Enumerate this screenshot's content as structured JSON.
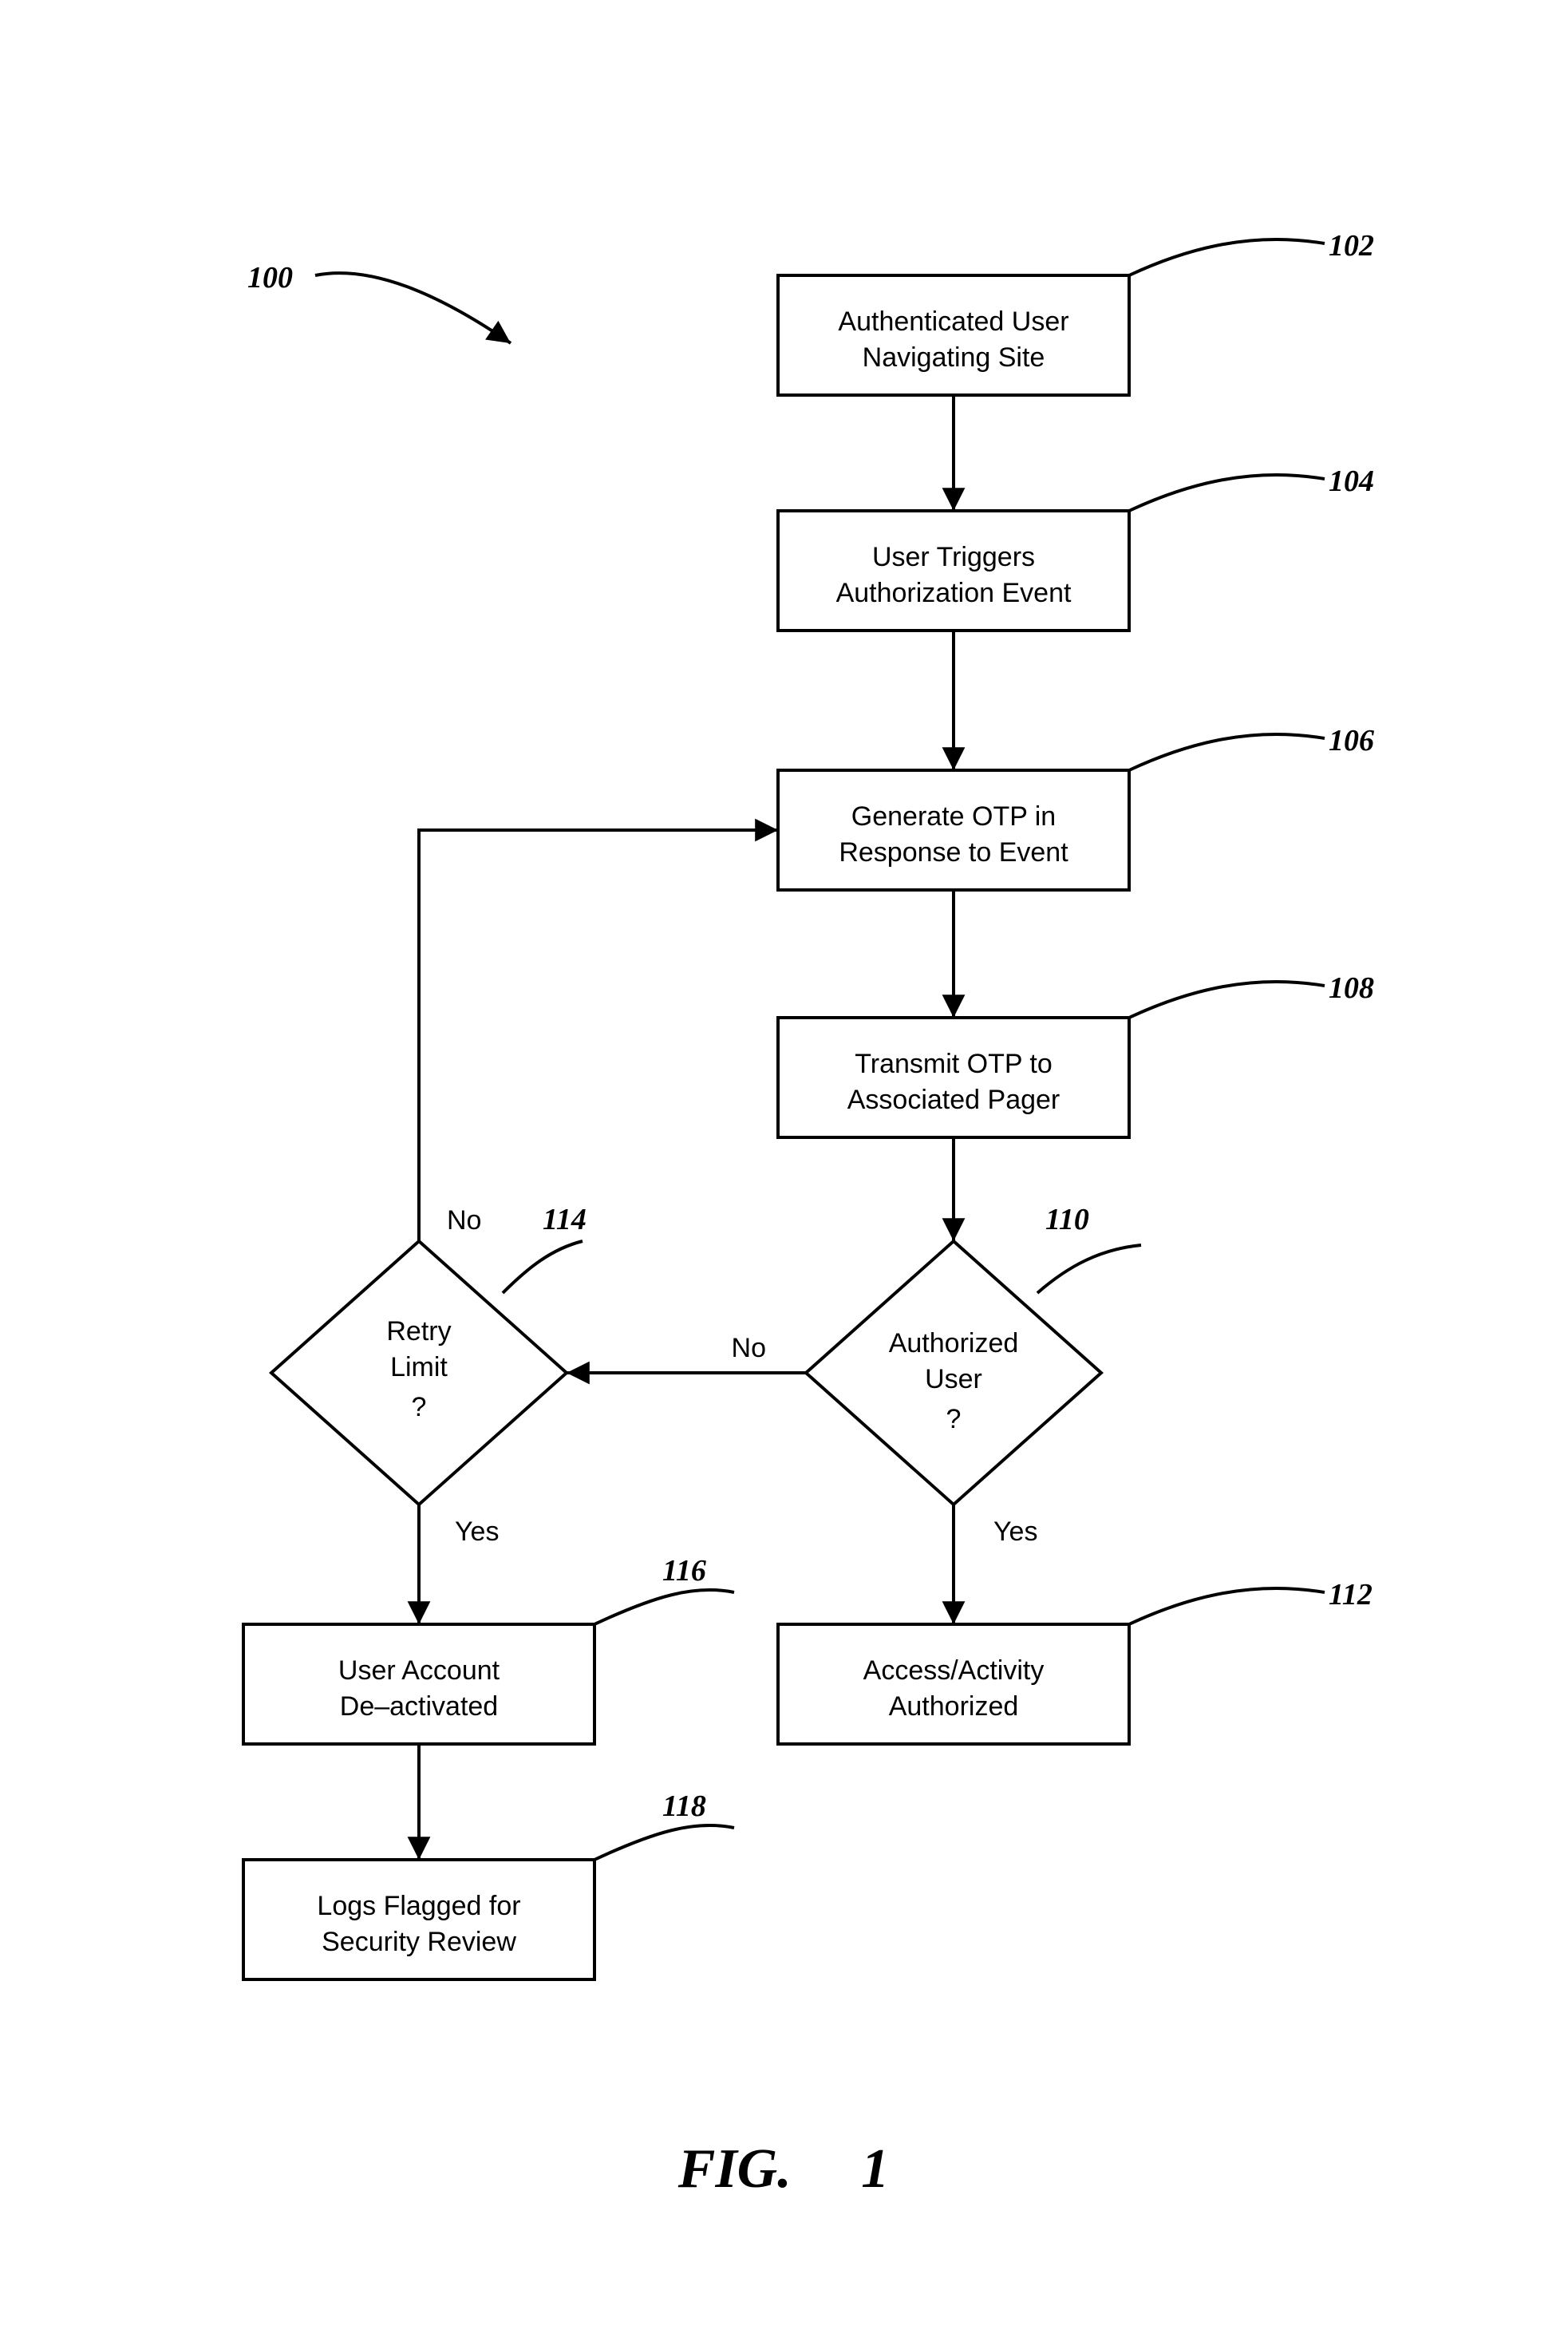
{
  "refs": {
    "r100": "100",
    "r102": "102",
    "r104": "104",
    "r106": "106",
    "r108": "108",
    "r110": "110",
    "r112": "112",
    "r114": "114",
    "r116": "116",
    "r118": "118"
  },
  "boxes": {
    "b102": {
      "l1": "Authenticated User",
      "l2": "Navigating Site"
    },
    "b104": {
      "l1": "User Triggers",
      "l2": "Authorization Event"
    },
    "b106": {
      "l1": "Generate OTP in",
      "l2": "Response to Event"
    },
    "b108": {
      "l1": "Transmit OTP to",
      "l2": "Associated Pager"
    },
    "d110": {
      "l1": "Authorized",
      "l2": "User",
      "l3": "?"
    },
    "b112": {
      "l1": "Access/Activity",
      "l2": "Authorized"
    },
    "d114": {
      "l1": "Retry",
      "l2": "Limit",
      "l3": "?"
    },
    "b116": {
      "l1": "User Account",
      "l2": "De–activated"
    },
    "b118": {
      "l1": "Logs Flagged for",
      "l2": "Security Review"
    }
  },
  "edges": {
    "no110": "No",
    "yes110": "Yes",
    "no114": "No",
    "yes114": "Yes"
  },
  "caption": "FIG.  1"
}
